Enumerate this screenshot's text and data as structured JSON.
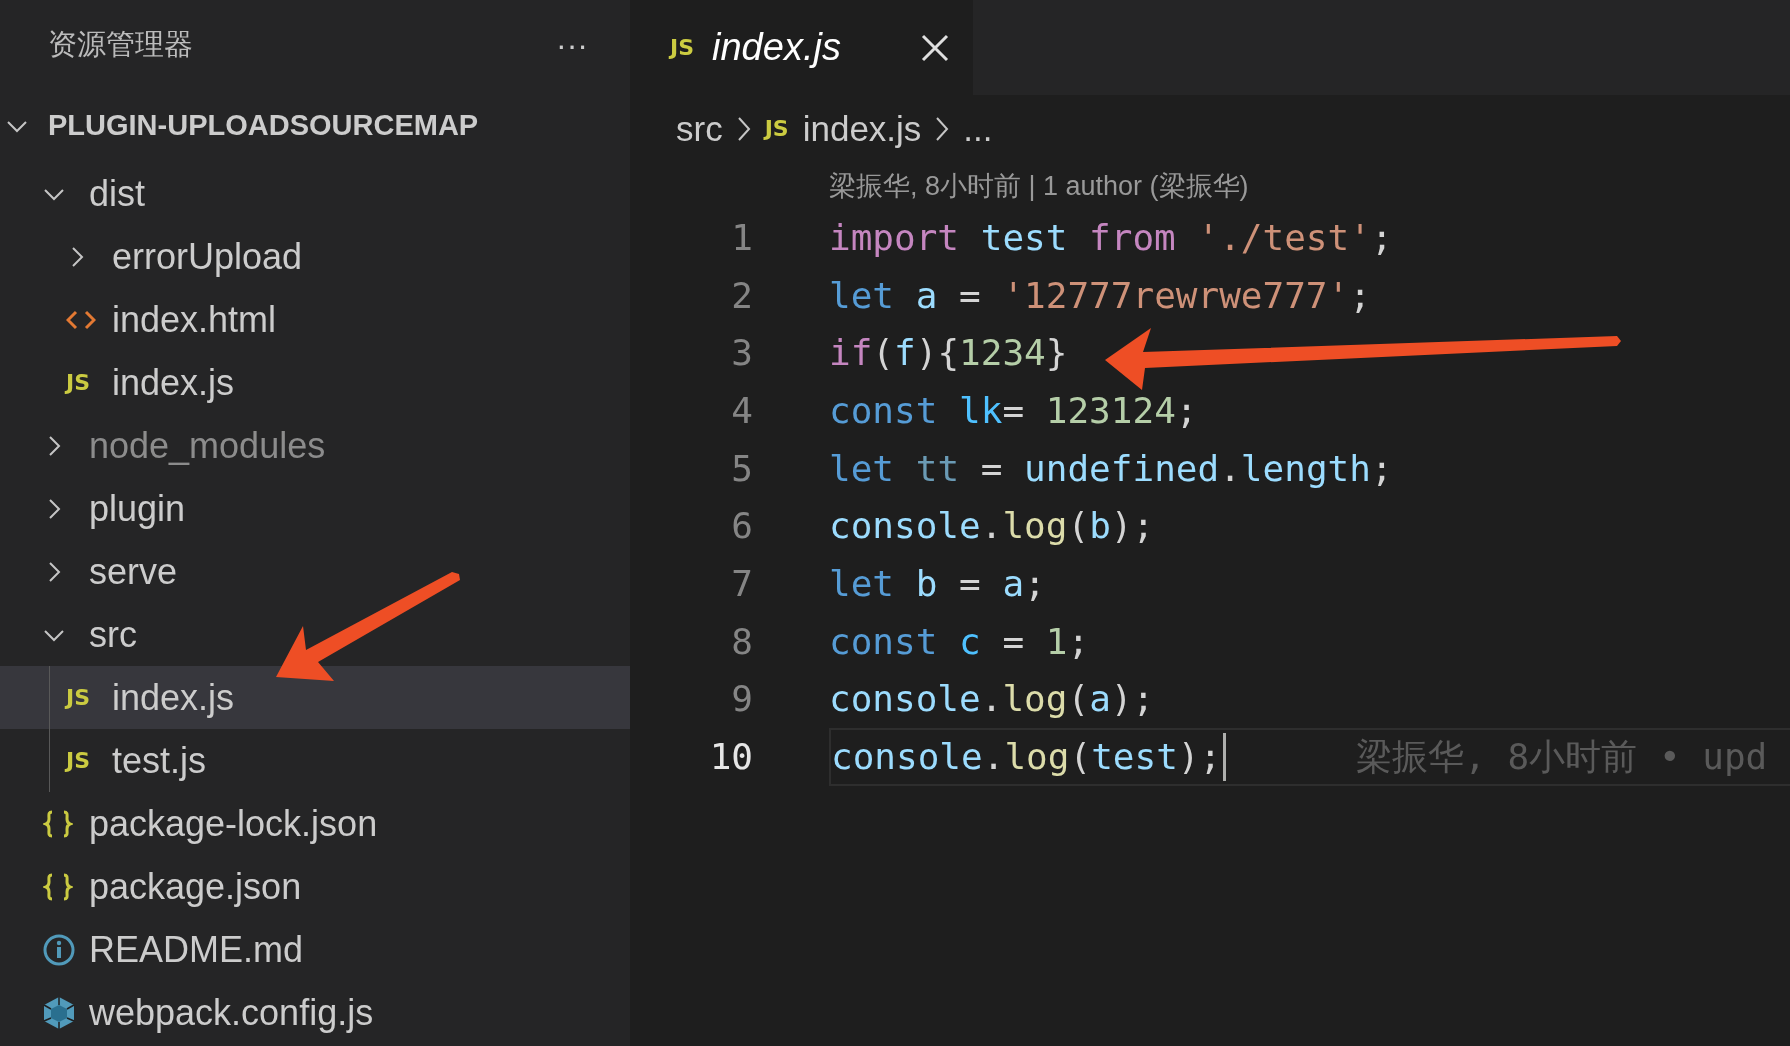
{
  "explorer": {
    "title": "资源管理器",
    "more_label": "···",
    "root": {
      "label": "PLUGIN-UPLOADSOURCEMAP",
      "expanded": true,
      "children": [
        {
          "kind": "folder",
          "label": "dist",
          "expanded": true,
          "selected": false,
          "dimmed": false,
          "children": [
            {
              "kind": "folder",
              "label": "errorUpload",
              "expanded": false,
              "selected": false,
              "dimmed": false
            },
            {
              "kind": "markup",
              "label": "index.html",
              "selected": false,
              "dimmed": false
            },
            {
              "kind": "script",
              "badge": "JS",
              "label": "index.js",
              "selected": false,
              "dimmed": false
            }
          ]
        },
        {
          "kind": "folder",
          "label": "node_modules",
          "expanded": false,
          "selected": false,
          "dimmed": true
        },
        {
          "kind": "folder",
          "label": "plugin",
          "expanded": false,
          "selected": false,
          "dimmed": false
        },
        {
          "kind": "folder",
          "label": "serve",
          "expanded": false,
          "selected": false,
          "dimmed": false
        },
        {
          "kind": "folder",
          "label": "src",
          "expanded": true,
          "selected": false,
          "dimmed": false,
          "children": [
            {
              "kind": "script",
              "badge": "JS",
              "label": "index.js",
              "selected": true,
              "dimmed": false
            },
            {
              "kind": "script",
              "badge": "JS",
              "label": "test.js",
              "selected": false,
              "dimmed": false
            }
          ]
        },
        {
          "kind": "data",
          "label": "package-lock.json",
          "selected": false,
          "dimmed": false
        },
        {
          "kind": "data",
          "label": "package.json",
          "selected": false,
          "dimmed": false
        },
        {
          "kind": "readme",
          "label": "README.md",
          "selected": false,
          "dimmed": false
        },
        {
          "kind": "bundler",
          "label": "webpack.config.js",
          "selected": false,
          "dimmed": false
        }
      ]
    }
  },
  "tabs": [
    {
      "kind": "script",
      "badge": "JS",
      "label": "index.js",
      "selected": true
    }
  ],
  "breadcrumb": [
    {
      "kind": "folder",
      "label": "src"
    },
    {
      "kind": "script",
      "badge": "JS",
      "label": "index.js"
    },
    {
      "kind": "more",
      "label": "..."
    }
  ],
  "blame_header": "梁振华, 8小时前 | 1 author (梁振华)",
  "code_lines": [
    {
      "number": "1",
      "current": false,
      "tokens": [
        {
          "kind": "keyword",
          "text": "import"
        },
        {
          "kind": "variable",
          "text": " test"
        },
        {
          "kind": "keyword",
          "text": " from"
        },
        {
          "kind": "string",
          "text": " './test'"
        },
        {
          "kind": "punct",
          "text": ";"
        }
      ]
    },
    {
      "number": "2",
      "current": false,
      "tokens": [
        {
          "kind": "storage",
          "text": "let"
        },
        {
          "kind": "variable",
          "text": " a"
        },
        {
          "kind": "punct",
          "text": " = "
        },
        {
          "kind": "string",
          "text": "'12777rewrwe777'"
        },
        {
          "kind": "punct",
          "text": ";"
        }
      ]
    },
    {
      "number": "3",
      "current": false,
      "tokens": [
        {
          "kind": "keyword",
          "text": "if"
        },
        {
          "kind": "punct",
          "text": "("
        },
        {
          "kind": "variable",
          "text": "f"
        },
        {
          "kind": "punct",
          "text": "){"
        },
        {
          "kind": "number",
          "text": "1234"
        },
        {
          "kind": "punct",
          "text": "}"
        }
      ]
    },
    {
      "number": "4",
      "current": false,
      "tokens": [
        {
          "kind": "storage",
          "text": "const"
        },
        {
          "kind": "constant",
          "text": " lk"
        },
        {
          "kind": "punct",
          "text": "= "
        },
        {
          "kind": "number",
          "text": "123124"
        },
        {
          "kind": "punct",
          "text": ";"
        }
      ]
    },
    {
      "number": "5",
      "current": false,
      "tokens": [
        {
          "kind": "storage",
          "text": "let"
        },
        {
          "kind": "unused",
          "text": " tt"
        },
        {
          "kind": "punct",
          "text": " = "
        },
        {
          "kind": "variable",
          "text": "undefined"
        },
        {
          "kind": "punct",
          "text": "."
        },
        {
          "kind": "variable",
          "text": "length"
        },
        {
          "kind": "punct",
          "text": ";"
        }
      ]
    },
    {
      "number": "6",
      "current": false,
      "tokens": [
        {
          "kind": "variable",
          "text": "console"
        },
        {
          "kind": "punct",
          "text": "."
        },
        {
          "kind": "function",
          "text": "log"
        },
        {
          "kind": "punct",
          "text": "("
        },
        {
          "kind": "variable",
          "text": "b"
        },
        {
          "kind": "punct",
          "text": ");"
        }
      ]
    },
    {
      "number": "7",
      "current": false,
      "tokens": [
        {
          "kind": "storage",
          "text": "let"
        },
        {
          "kind": "variable",
          "text": " b"
        },
        {
          "kind": "punct",
          "text": " = "
        },
        {
          "kind": "variable",
          "text": "a"
        },
        {
          "kind": "punct",
          "text": ";"
        }
      ]
    },
    {
      "number": "8",
      "current": false,
      "tokens": [
        {
          "kind": "storage",
          "text": "const"
        },
        {
          "kind": "constant",
          "text": " c"
        },
        {
          "kind": "punct",
          "text": " = "
        },
        {
          "kind": "number",
          "text": "1"
        },
        {
          "kind": "punct",
          "text": ";"
        }
      ]
    },
    {
      "number": "9",
      "current": false,
      "tokens": [
        {
          "kind": "variable",
          "text": "console"
        },
        {
          "kind": "punct",
          "text": "."
        },
        {
          "kind": "function",
          "text": "log"
        },
        {
          "kind": "punct",
          "text": "("
        },
        {
          "kind": "variable",
          "text": "a"
        },
        {
          "kind": "punct",
          "text": ");"
        }
      ]
    },
    {
      "number": "10",
      "current": true,
      "blame": "梁振华, 8小时前 • upd",
      "tokens": [
        {
          "kind": "variable",
          "text": "console"
        },
        {
          "kind": "punct",
          "text": "."
        },
        {
          "kind": "function",
          "text": "log"
        },
        {
          "kind": "punct",
          "text": "("
        },
        {
          "kind": "variable",
          "text": "test"
        },
        {
          "kind": "punct",
          "text": ");"
        }
      ]
    }
  ]
}
